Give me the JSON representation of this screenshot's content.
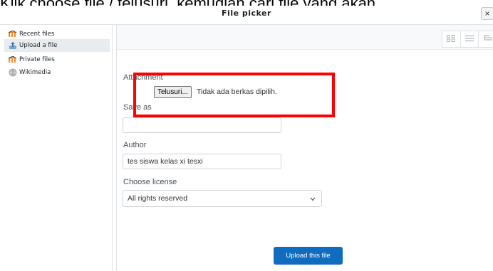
{
  "caption": "Klik choose file / telusuri, kemudian cari file yang akan",
  "dialog": {
    "title": "File picker",
    "close_glyph": "×"
  },
  "sidebar": {
    "items": [
      {
        "label": "Recent files",
        "icon": "moodle-logo-icon"
      },
      {
        "label": "Upload a file",
        "icon": "upload-icon"
      },
      {
        "label": "Private files",
        "icon": "moodle-logo-icon"
      },
      {
        "label": "Wikimedia",
        "icon": "wikimedia-icon"
      }
    ],
    "active_index": 1
  },
  "toolbar": {
    "views": [
      "grid-view-icon",
      "list-view-icon",
      "tree-view-icon"
    ]
  },
  "form": {
    "attachment_label": "Attachment",
    "file_button": "Telusuri...",
    "file_status": "Tidak ada berkas dipilih.",
    "save_as_label": "Save as",
    "save_as_value": "",
    "author_label": "Author",
    "author_value": "tes siswa kelas xi tesxi",
    "license_label": "Choose license",
    "license_value": "All rights reserved",
    "upload_button": "Upload this file"
  },
  "colors": {
    "primary": "#0f6cbf",
    "highlight_box": "#ff0000",
    "moodle_orange": "#f98012"
  }
}
